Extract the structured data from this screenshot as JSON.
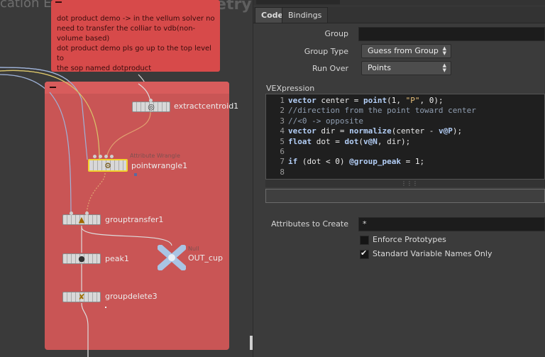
{
  "network": {
    "context_left": "cation Edition",
    "context_right": "Geometry",
    "sticky_note": {
      "lines": [
        "dot product demo -> in the vellum solver no",
        "need to transfer the colliar to vdb(non-",
        "volume based)",
        "dot product demo pls go up to the top level to",
        "the sop named dotproduct"
      ]
    },
    "nodes": {
      "extractcentroid": {
        "label": "extractcentroid1"
      },
      "pointwrangle": {
        "label": "pointwrangle1",
        "subtitle": "Attribute Wrangle"
      },
      "grouptransfer": {
        "label": "grouptransfer1"
      },
      "peak": {
        "label": "peak1"
      },
      "outcup": {
        "label": "OUT_cup",
        "subtitle": "Null"
      },
      "groupdelete": {
        "label": "groupdelete3"
      }
    }
  },
  "pane": {
    "tabs": [
      {
        "label": "Code",
        "active": true
      },
      {
        "label": "Bindings",
        "active": false
      }
    ],
    "group_label": "Group",
    "group_value": "",
    "group_type_label": "Group Type",
    "group_type_value": "Guess from Group",
    "run_over_label": "Run Over",
    "run_over_value": "Points",
    "vex_label": "VEXpression",
    "code_lines": [
      {
        "num": "1",
        "html": "<span class='kw'>vector</span> center = <span class='kw'>point</span>(<span class='num'>1</span>, <span class='str'>\"P\"</span>, <span class='num'>0</span>);"
      },
      {
        "num": "2",
        "html": "<span class='cm'>//direction from the point toward center</span>"
      },
      {
        "num": "3",
        "html": "<span class='cm'>//&lt;0 -&gt; opposite</span>"
      },
      {
        "num": "4",
        "html": "<span class='kw'>vector</span> dir = <span class='kw'>normalize</span>(center - <span class='kw'>v@P</span>);"
      },
      {
        "num": "5",
        "html": "<span class='kw'>float</span> dot = <span class='kw'>dot</span>(<span class='kw'>v@N</span>, dir);"
      },
      {
        "num": "6",
        "html": ""
      },
      {
        "num": "7",
        "html": "<span class='kw'>if</span> (dot &lt; <span class='num'>0</span>) <span class='kw'>@group_peak</span> = <span class='num'>1</span>;"
      },
      {
        "num": "8",
        "html": ""
      }
    ],
    "attributes_label": "Attributes to Create",
    "attributes_value": "*",
    "enforce_label": "Enforce Prototypes",
    "enforce_checked": false,
    "standard_label": "Standard Variable Names Only",
    "standard_checked": true
  },
  "colors": {
    "sticky": "#d74a4a",
    "netbox": "#c95555",
    "wire_yellow": "#d9c46a",
    "wire_blue": "#9fb3d9",
    "wire_orange": "#e0a070",
    "keyword": "#b2cdf5"
  }
}
